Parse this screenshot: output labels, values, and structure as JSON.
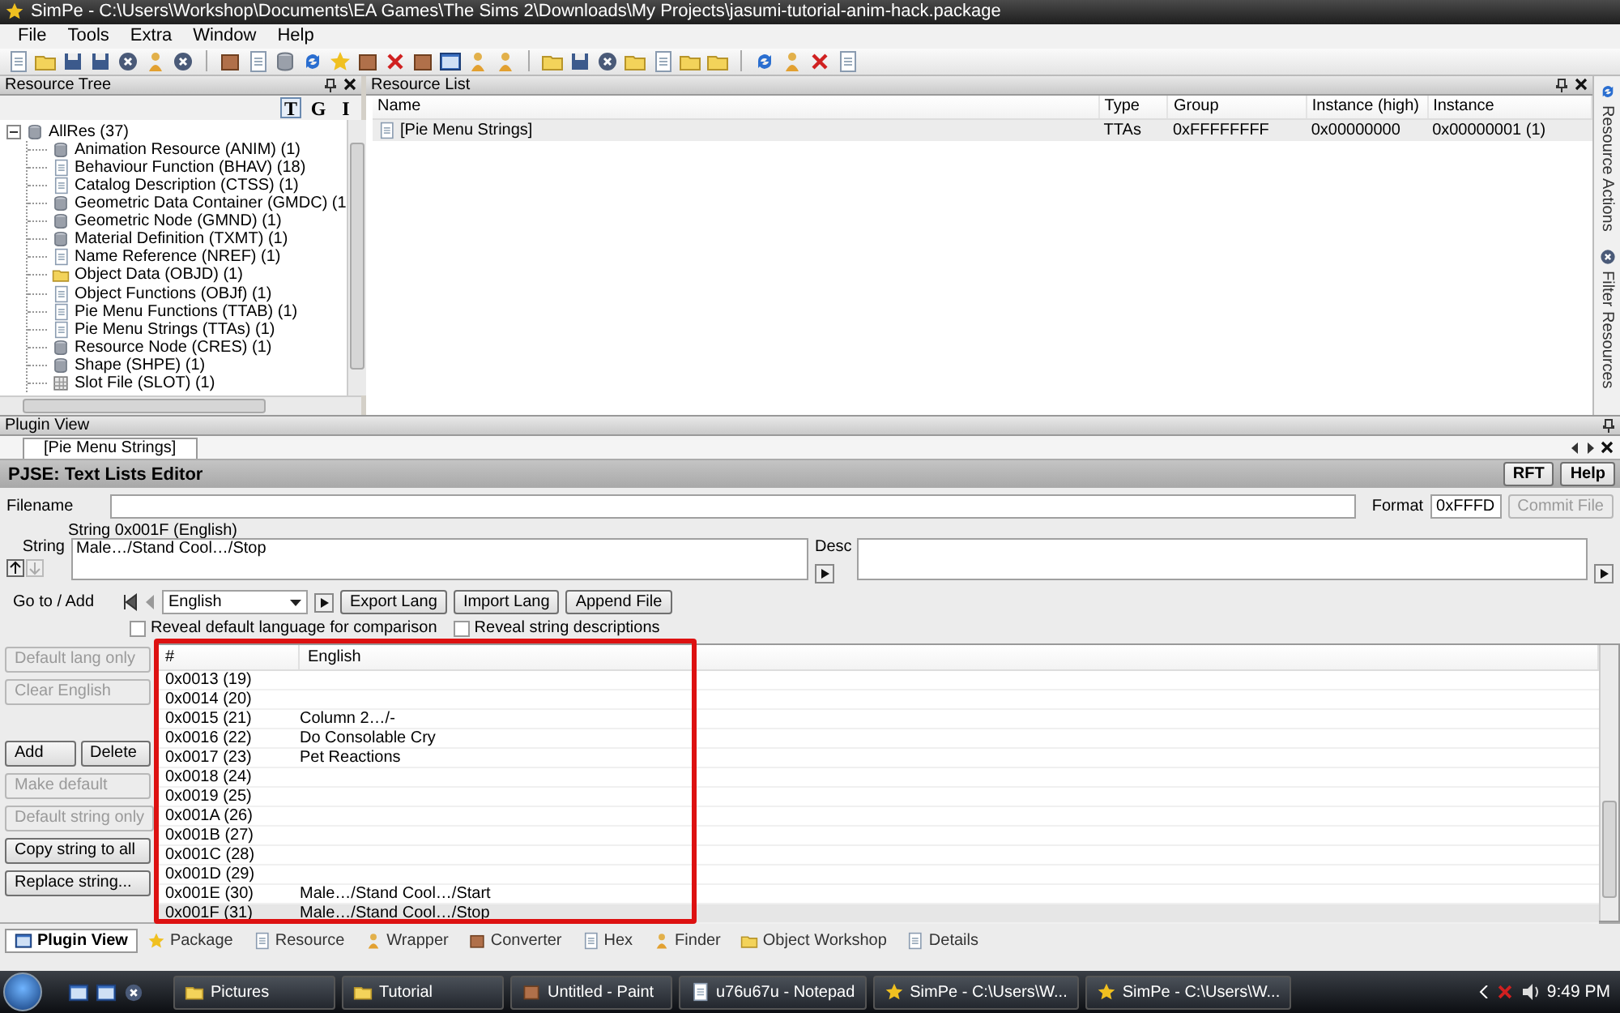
{
  "window": {
    "title": "SimPe - C:\\Users\\Workshop\\Documents\\EA Games\\The Sims 2\\Downloads\\My Projects\\jasumi-tutorial-anim-hack.package"
  },
  "menu": [
    "File",
    "Tools",
    "Extra",
    "Window",
    "Help"
  ],
  "resource_tree": {
    "title": "Resource Tree",
    "view_buttons": [
      {
        "label": "T",
        "selected": true
      },
      {
        "label": "G",
        "selected": false
      },
      {
        "label": "I",
        "selected": false
      }
    ],
    "root": {
      "label": "AllRes (37)",
      "expanded": true,
      "children": [
        {
          "label": "Animation Resource (ANIM) (1)",
          "kind": "cylinder"
        },
        {
          "label": "Behaviour Function (BHAV) (18)",
          "kind": "page"
        },
        {
          "label": "Catalog Description (CTSS) (1)",
          "kind": "page"
        },
        {
          "label": "Geometric Data Container (GMDC) (1",
          "kind": "cylinder"
        },
        {
          "label": "Geometric Node (GMND) (1)",
          "kind": "cylinder"
        },
        {
          "label": "Material Definition (TXMT) (1)",
          "kind": "cylinder"
        },
        {
          "label": "Name Reference (NREF) (1)",
          "kind": "page"
        },
        {
          "label": "Object Data (OBJD) (1)",
          "kind": "folder"
        },
        {
          "label": "Object Functions (OBJf) (1)",
          "kind": "page"
        },
        {
          "label": "Pie Menu Functions (TTAB) (1)",
          "kind": "page"
        },
        {
          "label": "Pie Menu Strings (TTAs) (1)",
          "kind": "page"
        },
        {
          "label": "Resource Node (CRES) (1)",
          "kind": "cylinder"
        },
        {
          "label": "Shape (SHPE) (1)",
          "kind": "cylinder"
        },
        {
          "label": "Slot File (SLOT) (1)",
          "kind": "grid"
        }
      ]
    }
  },
  "resource_list": {
    "title": "Resource List",
    "columns": [
      "Name",
      "Type",
      "Group",
      "Instance (high)",
      "Instance"
    ],
    "rows": [
      {
        "cells": [
          "[Pie Menu Strings]",
          "TTAs",
          "0xFFFFFFFF",
          "0x00000000",
          "0x00000001 (1)"
        ],
        "selected": true
      }
    ]
  },
  "side_tabs": [
    "Resource Actions",
    "Filter Resources"
  ],
  "plugin_view": {
    "title": "Plugin View",
    "doc_tab": "[Pie Menu Strings]",
    "editor_title": "PJSE: Text Lists Editor",
    "header_buttons": [
      "RFT",
      "Help"
    ],
    "filename_label": "Filename",
    "format_label": "Format",
    "format_value": "0xFFFD",
    "commit_button": {
      "label": "Commit File",
      "disabled": true
    },
    "string_caption": "String 0x001F (English)",
    "string_label": "String",
    "string_value": "Male…/Stand Cool…/Stop",
    "desc_label": "Desc",
    "goto_label": "Go to / Add",
    "language": "English",
    "lang_buttons": [
      "Export Lang",
      "Import Lang",
      "Append File"
    ],
    "checkboxes": [
      {
        "label": "Reveal default language for comparison",
        "checked": false
      },
      {
        "label": "Reveal string descriptions",
        "checked": false
      }
    ],
    "side_buttons": [
      [
        {
          "label": "Default lang only",
          "disabled": true
        }
      ],
      [
        {
          "label": "Clear English",
          "disabled": true
        }
      ],
      [
        {
          "label": "Add",
          "disabled": false
        },
        {
          "label": "Delete",
          "disabled": false
        }
      ],
      [
        {
          "label": "Make default",
          "disabled": true
        }
      ],
      [
        {
          "label": "Default string only",
          "disabled": true
        }
      ],
      [
        {
          "label": "Copy string to all",
          "disabled": false
        }
      ],
      [
        {
          "label": "Replace string...",
          "disabled": false
        }
      ]
    ],
    "table": {
      "columns": [
        "#",
        "English"
      ],
      "highlight_frame": true,
      "rows": [
        {
          "id": "0x0013 (19)",
          "selected": false
        },
        {
          "id": "0x0014 (20)",
          "selected": false
        },
        {
          "id": "0x0015 (21)",
          "english": "Column 2…/-",
          "selected": false
        },
        {
          "id": "0x0016 (22)",
          "english": "Do Consolable Cry",
          "selected": false
        },
        {
          "id": "0x0017 (23)",
          "english": "Pet Reactions",
          "selected": false
        },
        {
          "id": "0x0018 (24)",
          "selected": false
        },
        {
          "id": "0x0019 (25)",
          "selected": false
        },
        {
          "id": "0x001A (26)",
          "selected": false
        },
        {
          "id": "0x001B (27)",
          "selected": false
        },
        {
          "id": "0x001C (28)",
          "selected": false
        },
        {
          "id": "0x001D (29)",
          "selected": false
        },
        {
          "id": "0x001E (30)",
          "english": "Male…/Stand Cool…/Start",
          "selected": false
        },
        {
          "id": "0x001F (31)",
          "english": "Male…/Stand Cool…/Stop",
          "selected": true
        }
      ]
    }
  },
  "bottom_tabs": [
    {
      "label": "Plugin View",
      "selected": true
    },
    {
      "label": "Package",
      "selected": false
    },
    {
      "label": "Resource",
      "selected": false
    },
    {
      "label": "Wrapper",
      "selected": false
    },
    {
      "label": "Converter",
      "selected": false
    },
    {
      "label": "Hex",
      "selected": false
    },
    {
      "label": "Finder",
      "selected": false
    },
    {
      "label": "Object Workshop",
      "selected": false
    },
    {
      "label": "Details",
      "selected": false
    }
  ],
  "taskbar": {
    "tasks": [
      {
        "label": "Pictures"
      },
      {
        "label": "Tutorial"
      },
      {
        "label": "Untitled - Paint"
      },
      {
        "label": "u76u67u - Notepad"
      },
      {
        "label": "SimPe - C:\\Users\\W..."
      },
      {
        "label": "SimPe - C:\\Users\\W..."
      }
    ],
    "clock": "9:49 PM"
  }
}
